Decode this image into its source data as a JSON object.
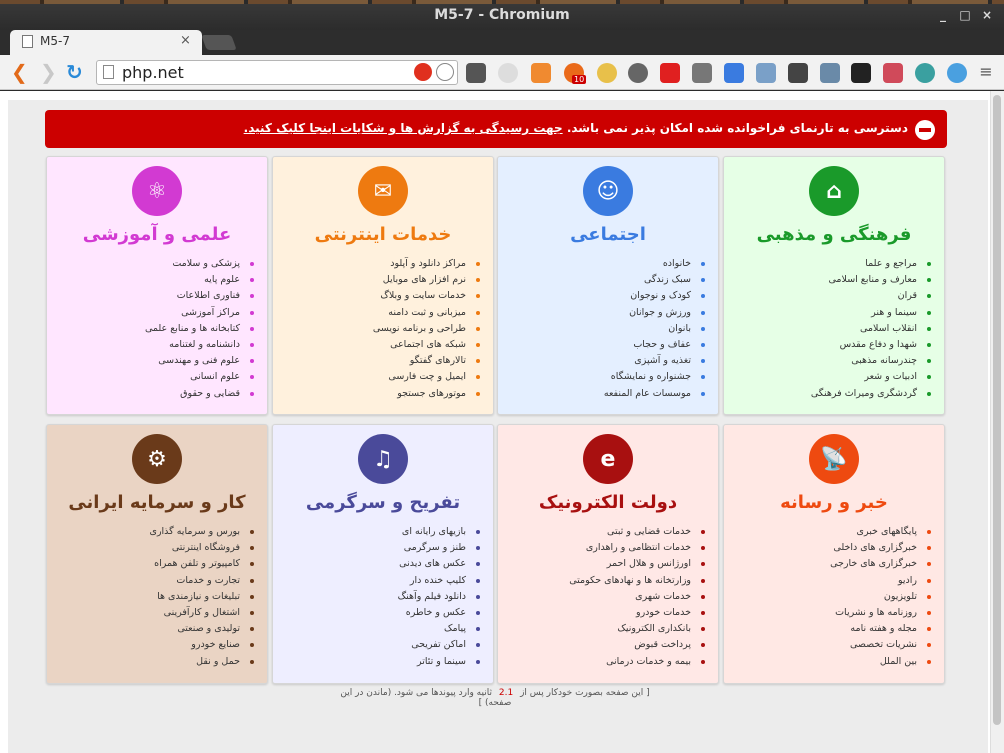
{
  "window": {
    "title": "M5-7 - Chromium",
    "controls": [
      "_",
      "□",
      "×"
    ]
  },
  "tabs": [
    {
      "title": "M5-7",
      "close": "×"
    }
  ],
  "toolbar": {
    "url": "php.net",
    "extensions_badge": "10"
  },
  "alert": {
    "text": "دسترسی به تارنمای فراخوانده شده امکان پذیر نمی باشد.",
    "link_text": "جهت رسیدگی به گزارش ها و شکایات اینجا کلیک کنید."
  },
  "categories": [
    {
      "title": "فرهنگی و مذهبی",
      "color": "#1a9a2a",
      "bg": "#e6ffe6",
      "icon": "mosque-icon",
      "glyph": "⌂",
      "items": [
        "مراجع و علما",
        "معارف و منابع اسلامی",
        "قران",
        "سینما و هنر",
        "انقلاب اسلامی",
        "شهدا و دفاع مقدس",
        "چندرسانه مذهبی",
        "ادبیات و شعر",
        "گردشگری ومیراث فرهنگی"
      ]
    },
    {
      "title": "اجتماعی",
      "color": "#3a7be0",
      "bg": "#e4efff",
      "icon": "family-icon",
      "glyph": "☺",
      "items": [
        "خانواده",
        "سبک زندگی",
        "کودک و نوجوان",
        "ورزش و جوانان",
        "بانوان",
        "عفاف و حجاب",
        "تغذیه و آشپزی",
        "جشنواره و نمایشگاه",
        "موسسات عام المنفعه"
      ]
    },
    {
      "title": "خدمات اینترنتی",
      "color": "#ee7a10",
      "bg": "#fff1dd",
      "icon": "internet-services-icon",
      "glyph": "✉",
      "items": [
        "مراکز دانلود و آپلود",
        "نرم افزار های موبایل",
        "خدمات سایت و وبلاگ",
        "میزبانی و ثبت دامنه",
        "طراحی و برنامه نویسی",
        "شبکه های اجتماعی",
        "تالارهای گفتگو",
        "ایمیل و چت فارسی",
        "موتورهای جستجو"
      ]
    },
    {
      "title": "علمی و آموزشی",
      "color": "#d23ad2",
      "bg": "#ffe6ff",
      "icon": "atom-icon",
      "glyph": "⚛",
      "items": [
        "پزشکی و سلامت",
        "علوم پایه",
        "فناوری اطلاعات",
        "مراکز آموزشی",
        "کتابخانه ها و منابع علمی",
        "دانشنامه و لغتنامه",
        "علوم فنی و مهندسی",
        "علوم انسانی",
        "قضایی و حقوق"
      ]
    },
    {
      "title": "خبر و رسانه",
      "color": "#ee4a10",
      "bg": "#ffe8e4",
      "icon": "satellite-dish-icon",
      "glyph": "📡",
      "items": [
        "پایگاههای خبری",
        "خبرگزاری های داخلی",
        "خبرگزاری های خارجی",
        "رادیو",
        "تلویزیون",
        "روزنامه ها و نشریات",
        "مجله و هفته نامه",
        "نشریات تخصصی",
        "بین الملل"
      ]
    },
    {
      "title": "دولت الکترونیک",
      "color": "#a81010",
      "bg": "#ffe8e6",
      "icon": "e-government-icon",
      "glyph": "e",
      "items": [
        "خدمات قضایی و ثبتی",
        "خدمات انتظامی و راهداری",
        "اورژانس و هلال احمر",
        "وزارتخانه ها و نهادهای حکومتی",
        "خدمات شهری",
        "خدمات خودرو",
        "بانکداری الکترونیک",
        "پرداخت قبوض",
        "بیمه و خدمات درمانی"
      ]
    },
    {
      "title": "تفریح و سرگرمی",
      "color": "#4a4a9a",
      "bg": "#eeeeff",
      "icon": "entertainment-icon",
      "glyph": "♫",
      "items": [
        "بازیهای رایانه ای",
        "طنز و سرگرمی",
        "عکس های دیدنی",
        "کلیپ خنده دار",
        "دانلود فیلم وآهنگ",
        "عکس و خاطره",
        "پیامک",
        "اماکن تفریحی",
        "سینما و تئاتر"
      ]
    },
    {
      "title": "کار و سرمایه ایرانی",
      "color": "#6a3a1a",
      "bg": "#ead4c4",
      "icon": "business-icon",
      "glyph": "⚙",
      "items": [
        "بورس و سرمایه گذاری",
        "فروشگاه اینترنتی",
        "کامپیوتر و تلفن همراه",
        "تجارت و خدمات",
        "تبلیغات و نیازمندی ها",
        "اشتغال و کارآفرینی",
        "تولیدی و صنعتی",
        "صنایع خودرو",
        "حمل و نقل"
      ]
    }
  ],
  "footer": {
    "prefix": "[ این صفحه بصورت خودکار پس از",
    "seconds": "2.1",
    "suffix": "ثانیه وارد پیوندها می شود. (ماندن در این صفحه) ]"
  }
}
